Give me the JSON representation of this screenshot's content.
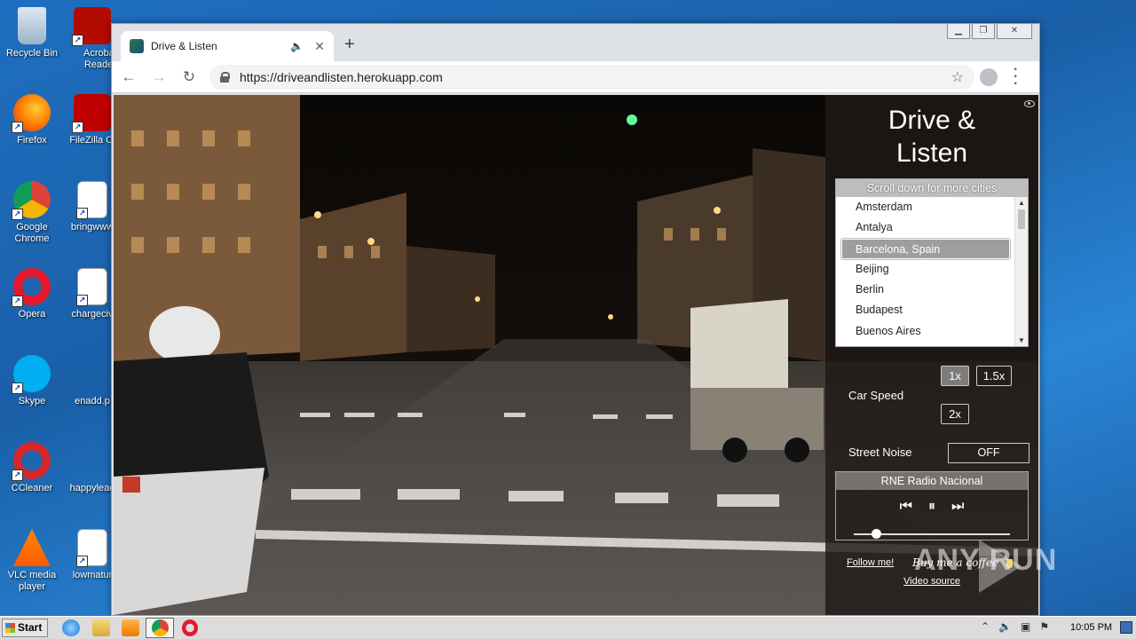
{
  "desktop": {
    "icons": [
      {
        "label": "Recycle Bin"
      },
      {
        "label": "Acrobat Reader"
      },
      {
        "label": "Firefox"
      },
      {
        "label": "FileZilla Cl"
      },
      {
        "label": "Google Chrome"
      },
      {
        "label": "bringwww"
      },
      {
        "label": "Opera"
      },
      {
        "label": "chargeciv"
      },
      {
        "label": "Skype"
      },
      {
        "label": "enadd.p"
      },
      {
        "label": "CCleaner"
      },
      {
        "label": "happylead"
      },
      {
        "label": "VLC media player"
      },
      {
        "label": "lowmatur"
      }
    ]
  },
  "browser": {
    "tab_title": "Drive & Listen",
    "url": "https://driveandlisten.herokuapp.com",
    "new_tab": "+",
    "close_tab": "✕"
  },
  "panel": {
    "title": "Drive & Listen",
    "city_header": "Scroll down for more cities",
    "cities": [
      "Amsterdam",
      "Antalya",
      "Barcelona, Spain",
      "Beijing",
      "Berlin",
      "Budapest",
      "Buenos Aires"
    ],
    "selected_city": "Barcelona, Spain",
    "car_speed_label": "Car Speed",
    "speed_options": [
      "1x",
      "1.5x",
      "2x"
    ],
    "speed_selected": "1x",
    "street_noise_label": "Street Noise",
    "street_noise_value": "OFF",
    "radio_station": "RNE Radio Nacional",
    "volume_level": 0.14,
    "follow_link": "Follow me!",
    "coffee_text": "Buy me a coffee",
    "video_source_link": "Video source"
  },
  "watermark": "ANY RUN",
  "taskbar": {
    "start_label": "Start",
    "clock": "10:05 PM"
  },
  "colors": {
    "desktop_bg": "#1f6fc0",
    "panel_bg": "#1e1a16",
    "selected_city_bg": "#9e9e9e"
  }
}
